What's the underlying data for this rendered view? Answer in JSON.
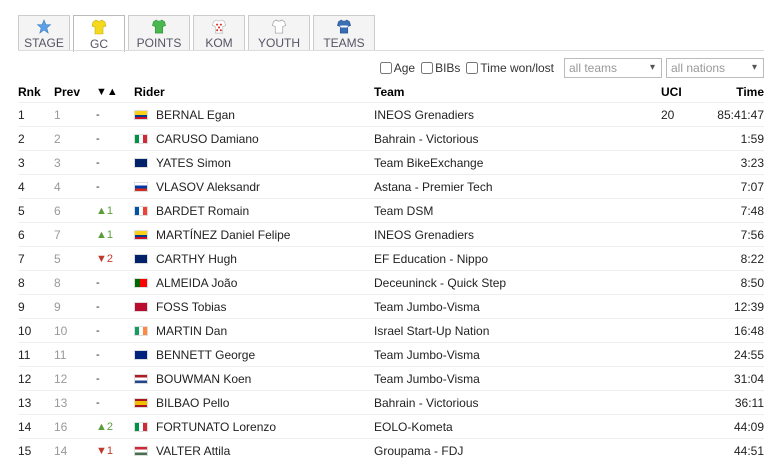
{
  "tabs": [
    {
      "label": "STAGE",
      "icon": "star-icon",
      "color": "#4a90d9"
    },
    {
      "label": "GC",
      "icon": "jersey-yellow-icon",
      "color": "#f2d21b",
      "active": true
    },
    {
      "label": "POINTS",
      "icon": "jersey-green-icon",
      "color": "#3fae49"
    },
    {
      "label": "KOM",
      "icon": "jersey-polka-icon",
      "color": "#d9322a"
    },
    {
      "label": "YOUTH",
      "icon": "jersey-white-icon",
      "color": "#ffffff"
    },
    {
      "label": "TEAMS",
      "icon": "jersey-blue-icon",
      "color": "#3a6fb5"
    }
  ],
  "filters": {
    "age_label": "Age",
    "bibs_label": "BIBs",
    "time_label": "Time won/lost",
    "teams_select": "all teams",
    "nations_select": "all nations"
  },
  "table": {
    "headers": {
      "rnk": "Rnk",
      "prev": "Prev",
      "arrows": "▼▲",
      "rider": "Rider",
      "team": "Team",
      "uci": "UCI",
      "time": "Time"
    },
    "rows": [
      {
        "rnk": "1",
        "prev": "1",
        "change": "-",
        "dir": "",
        "flag": "co",
        "rider": "BERNAL Egan",
        "team": "INEOS Grenadiers",
        "uci": "20",
        "time": "85:41:47"
      },
      {
        "rnk": "2",
        "prev": "2",
        "change": "-",
        "dir": "",
        "flag": "it",
        "rider": "CARUSO Damiano",
        "team": "Bahrain - Victorious",
        "uci": "",
        "time": "1:59"
      },
      {
        "rnk": "3",
        "prev": "3",
        "change": "-",
        "dir": "",
        "flag": "gb",
        "rider": "YATES Simon",
        "team": "Team BikeExchange",
        "uci": "",
        "time": "3:23"
      },
      {
        "rnk": "4",
        "prev": "4",
        "change": "-",
        "dir": "",
        "flag": "ru",
        "rider": "VLASOV Aleksandr",
        "team": "Astana - Premier Tech",
        "uci": "",
        "time": "7:07"
      },
      {
        "rnk": "5",
        "prev": "6",
        "change": "▲1",
        "dir": "up",
        "flag": "fr",
        "rider": "BARDET Romain",
        "team": "Team DSM",
        "uci": "",
        "time": "7:48"
      },
      {
        "rnk": "6",
        "prev": "7",
        "change": "▲1",
        "dir": "up",
        "flag": "co",
        "rider": "MARTÍNEZ Daniel Felipe",
        "team": "INEOS Grenadiers",
        "uci": "",
        "time": "7:56"
      },
      {
        "rnk": "7",
        "prev": "5",
        "change": "▼2",
        "dir": "down",
        "flag": "gb",
        "rider": "CARTHY Hugh",
        "team": "EF Education - Nippo",
        "uci": "",
        "time": "8:22"
      },
      {
        "rnk": "8",
        "prev": "8",
        "change": "-",
        "dir": "",
        "flag": "pt",
        "rider": "ALMEIDA João",
        "team": "Deceuninck - Quick Step",
        "uci": "",
        "time": "8:50"
      },
      {
        "rnk": "9",
        "prev": "9",
        "change": "-",
        "dir": "",
        "flag": "no",
        "rider": "FOSS Tobias",
        "team": "Team Jumbo-Visma",
        "uci": "",
        "time": "12:39"
      },
      {
        "rnk": "10",
        "prev": "10",
        "change": "-",
        "dir": "",
        "flag": "ie",
        "rider": "MARTIN Dan",
        "team": "Israel Start-Up Nation",
        "uci": "",
        "time": "16:48"
      },
      {
        "rnk": "11",
        "prev": "11",
        "change": "-",
        "dir": "",
        "flag": "nz",
        "rider": "BENNETT George",
        "team": "Team Jumbo-Visma",
        "uci": "",
        "time": "24:55"
      },
      {
        "rnk": "12",
        "prev": "12",
        "change": "-",
        "dir": "",
        "flag": "nl",
        "rider": "BOUWMAN Koen",
        "team": "Team Jumbo-Visma",
        "uci": "",
        "time": "31:04"
      },
      {
        "rnk": "13",
        "prev": "13",
        "change": "-",
        "dir": "",
        "flag": "es",
        "rider": "BILBAO Pello",
        "team": "Bahrain - Victorious",
        "uci": "",
        "time": "36:11"
      },
      {
        "rnk": "14",
        "prev": "16",
        "change": "▲2",
        "dir": "up",
        "flag": "it",
        "rider": "FORTUNATO Lorenzo",
        "team": "EOLO-Kometa",
        "uci": "",
        "time": "44:09"
      },
      {
        "rnk": "15",
        "prev": "14",
        "change": "▼1",
        "dir": "down",
        "flag": "hu",
        "rider": "VALTER Attila",
        "team": "Groupama - FDJ",
        "uci": "",
        "time": "44:51"
      }
    ]
  }
}
